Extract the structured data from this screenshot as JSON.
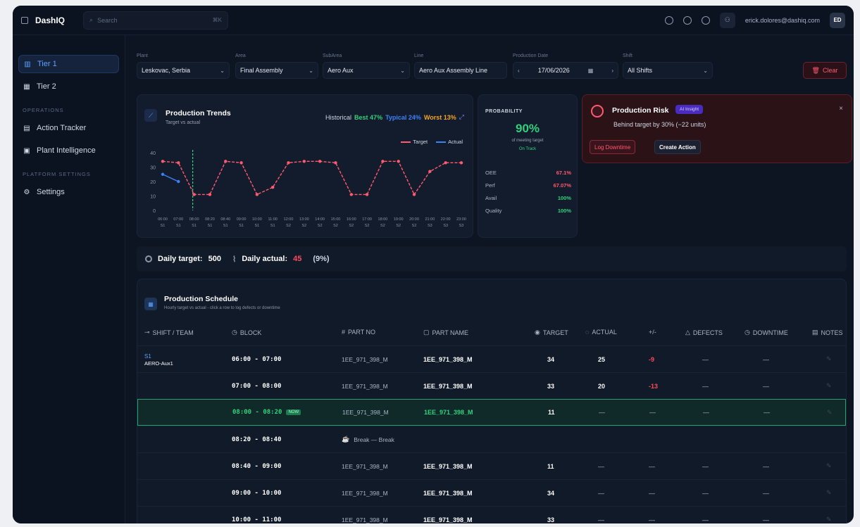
{
  "app": {
    "name": "DashIQ",
    "search_placeholder": "Search",
    "search_kbd": "⌘K",
    "email": "erick.dolores@dashiq.com",
    "avatar_initials": "ED"
  },
  "sidebar": {
    "tier1": "Tier 1",
    "tier2": "Tier 2",
    "operations_header": "OPERATIONS",
    "action_tracker": "Action Tracker",
    "plant_intelligence": "Plant Intelligence",
    "platform_header": "PLATFORM SETTINGS",
    "settings": "Settings"
  },
  "filters": {
    "plant": {
      "label": "Plant",
      "value": "Leskovac, Serbia"
    },
    "area": {
      "label": "Area",
      "value": "Final Assembly"
    },
    "subarea": {
      "label": "SubArea",
      "value": "Aero Aux"
    },
    "line": {
      "label": "Line",
      "value": "Aero Aux Assembly Line"
    },
    "date": {
      "label": "Production Date",
      "value": "17/06/2026"
    },
    "shift": {
      "label": "Shift",
      "value": "All Shifts"
    },
    "clear": "Clear"
  },
  "trends": {
    "title": "Production Trends",
    "subtitle": "Target vs actual",
    "historical_label": "Historical",
    "best": "Best 47%",
    "typical": "Typical 24%",
    "worst": "Worst 13%",
    "legend_target": "Target",
    "legend_actual": "Actual"
  },
  "chart_data": {
    "type": "line",
    "y_ticks": [
      0,
      10,
      20,
      30,
      40
    ],
    "ylim": [
      0,
      40
    ],
    "x_labels": [
      "06:00",
      "07:00",
      "08:00",
      "08:20",
      "08:40",
      "09:00",
      "10:00",
      "11:00",
      "12:00",
      "13:00",
      "14:00",
      "15:00",
      "16:00",
      "17:00",
      "18:00",
      "19:00",
      "20:00",
      "21:00",
      "22:00",
      "23:00"
    ],
    "x_shifts": [
      "S1",
      "S1",
      "S1",
      "S1",
      "S1",
      "S1",
      "S1",
      "S1",
      "S2",
      "S2",
      "S2",
      "S2",
      "S2",
      "S2",
      "S2",
      "S2",
      "S2",
      "S3",
      "S3",
      "S3"
    ],
    "series": [
      {
        "name": "Target",
        "color": "#ff5a6e",
        "values": [
          34,
          33,
          11,
          11,
          34,
          33,
          11,
          16,
          33,
          34,
          34,
          33,
          11,
          11,
          34,
          34,
          11,
          27,
          33,
          33
        ]
      },
      {
        "name": "Actual",
        "color": "#3b82f6",
        "values": [
          25,
          20,
          null,
          null,
          null,
          null,
          null,
          null,
          null,
          null,
          null,
          null,
          null,
          null,
          null,
          null,
          null,
          null,
          null,
          null
        ]
      }
    ]
  },
  "probability": {
    "title": "PROBABILITY",
    "value": "90%",
    "subtitle": "of meeting target",
    "status": "On Track",
    "metrics": [
      {
        "name": "OEE",
        "value": "67.1%"
      },
      {
        "name": "Perf",
        "value": "67.07%"
      },
      {
        "name": "Avail",
        "value": "100%"
      },
      {
        "name": "Quality",
        "value": "100%"
      }
    ]
  },
  "risk": {
    "title": "Production Risk",
    "badge": "AI Insight",
    "description": "Behind target by 30% (−22 units)",
    "log_downtime": "Log Downtime",
    "create_action": "Create Action"
  },
  "daily": {
    "target_label": "Daily target:",
    "target_value": "500",
    "actual_label": "Daily actual:",
    "actual_value": "45",
    "pct": "(9%)"
  },
  "schedule": {
    "title": "Production Schedule",
    "subtitle": "Hourly target vs actual - click a row to log defects or downtime",
    "headers": {
      "shift": "SHIFT / TEAM",
      "block": "BLOCK",
      "part_no": "PART NO",
      "part_name": "PART NAME",
      "target": "TARGET",
      "actual": "ACTUAL",
      "diff": "+/-",
      "defects": "DEFECTS",
      "downtime": "DOWNTIME",
      "notes": "NOTES"
    },
    "shift_name": "S1",
    "team_name": "AERO-Aux1",
    "now_tag": "NOW",
    "rows": [
      {
        "block": "06:00 - 07:00",
        "part_no": "1EE_971_398_M",
        "part_name": "1EE_971_398_M",
        "target": "34",
        "actual": "25",
        "diff": "-9",
        "defects": "—",
        "downtime": "—"
      },
      {
        "block": "07:00 - 08:00",
        "part_no": "1EE_971_398_M",
        "part_name": "1EE_971_398_M",
        "target": "33",
        "actual": "20",
        "diff": "-13",
        "defects": "—",
        "downtime": "—"
      },
      {
        "block": "08:00 - 08:20",
        "part_no": "1EE_971_398_M",
        "part_name": "1EE_971_398_M",
        "target": "11",
        "actual": "—",
        "diff": "—",
        "defects": "—",
        "downtime": "—"
      },
      {
        "block": "08:20 - 08:40",
        "part_no": "Break — Break",
        "part_name": "",
        "target": "",
        "actual": "",
        "diff": "",
        "defects": "",
        "downtime": ""
      },
      {
        "block": "08:40 - 09:00",
        "part_no": "1EE_971_398_M",
        "part_name": "1EE_971_398_M",
        "target": "11",
        "actual": "—",
        "diff": "—",
        "defects": "—",
        "downtime": "—"
      },
      {
        "block": "09:00 - 10:00",
        "part_no": "1EE_971_398_M",
        "part_name": "1EE_971_398_M",
        "target": "34",
        "actual": "—",
        "diff": "—",
        "defects": "—",
        "downtime": "—"
      },
      {
        "block": "10:00 - 11:00",
        "part_no": "1EE_971_398_M",
        "part_name": "1EE_971_398_M",
        "target": "33",
        "actual": "—",
        "diff": "—",
        "defects": "—",
        "downtime": "—"
      }
    ]
  }
}
